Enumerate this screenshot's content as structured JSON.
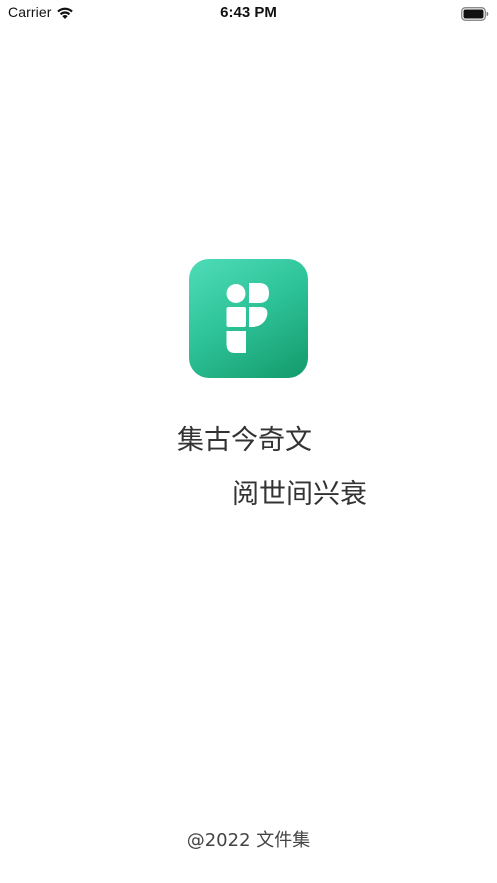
{
  "status_bar": {
    "carrier": "Carrier",
    "time": "6:43 PM",
    "icons": [
      "wifi-icon",
      "battery-icon"
    ]
  },
  "splash": {
    "app_icon": "app-logo-icon",
    "brand_colors": {
      "gradient_light": "#4fdcb8",
      "gradient_dark": "#139a6a"
    },
    "slogan_line_1": "集古今奇文",
    "slogan_line_2": "阅世间兴衰"
  },
  "footer": {
    "copyright": "@2022 文件集"
  }
}
